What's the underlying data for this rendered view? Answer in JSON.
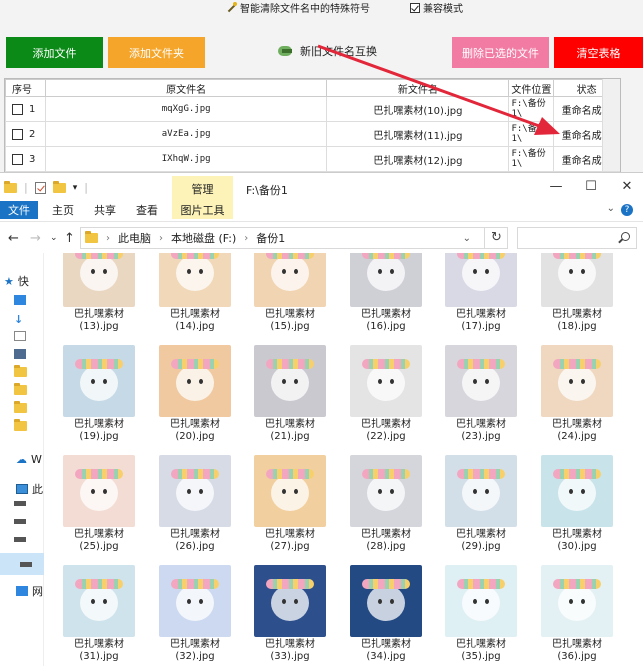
{
  "app": {
    "clean_option": "智能清除文件名中的特殊符号",
    "compat_option": "兼容模式",
    "compat_checked": true,
    "buttons": {
      "add_file": "添加文件",
      "add_folder": "添加文件夹",
      "swap_names": "新旧文件名互换",
      "delete_selected": "删除已选的文件",
      "clear_table": "清空表格"
    },
    "table": {
      "headers": [
        "序号",
        "原文件名",
        "新文件名",
        "文件位置",
        "状态"
      ],
      "rows": [
        {
          "index": "1",
          "original": "mqXgG.jpg",
          "new": "巴扎嘿素材(10).jpg",
          "location": "F:\\备份1\\",
          "status": "重命名成功"
        },
        {
          "index": "2",
          "original": "aVzEa.jpg",
          "new": "巴扎嘿素材(11).jpg",
          "location": "F:\\备份1\\",
          "status": "重命名成功"
        },
        {
          "index": "3",
          "original": "IXhqW.jpg",
          "new": "巴扎嘿素材(12).jpg",
          "location": "F:\\备份1\\",
          "status": "重命名成功"
        }
      ]
    }
  },
  "explorer": {
    "title_path": "F:\\备份1",
    "manage_tab": "管理",
    "picture_tools_tab": "图片工具",
    "ribbon_tabs": [
      "文件",
      "主页",
      "共享",
      "查看"
    ],
    "breadcrumb": [
      "此电脑",
      "本地磁盘 (F:)",
      "备份1"
    ],
    "search_placeholder": "",
    "sidebar": [
      {
        "label": "快",
        "icon": "star-icon"
      },
      {
        "label": "W",
        "icon": "cloud-icon"
      },
      {
        "label": "此",
        "icon": "computer-icon"
      },
      {
        "label": "网",
        "icon": "network-icon"
      }
    ],
    "files": [
      {
        "name": "巴扎嘿素材",
        "num": "(13).jpg",
        "color": "#e9d7c2"
      },
      {
        "name": "巴扎嘿素材",
        "num": "(14).jpg",
        "color": "#f0d8b8"
      },
      {
        "name": "巴扎嘿素材",
        "num": "(15).jpg",
        "color": "#f1d4b2"
      },
      {
        "name": "巴扎嘿素材",
        "num": "(16).jpg",
        "color": "#cfcfd6"
      },
      {
        "name": "巴扎嘿素材",
        "num": "(17).jpg",
        "color": "#d9d9e6"
      },
      {
        "name": "巴扎嘿素材",
        "num": "(18).jpg",
        "color": "#e2e2e2"
      },
      {
        "name": "巴扎嘿素材",
        "num": "(19).jpg",
        "color": "#c6d9e6"
      },
      {
        "name": "巴扎嘿素材",
        "num": "(20).jpg",
        "color": "#f0c9a0"
      },
      {
        "name": "巴扎嘿素材",
        "num": "(21).jpg",
        "color": "#c9c9cf"
      },
      {
        "name": "巴扎嘿素材",
        "num": "(22).jpg",
        "color": "#e4e4e4"
      },
      {
        "name": "巴扎嘿素材",
        "num": "(23).jpg",
        "color": "#d6d6dc"
      },
      {
        "name": "巴扎嘿素材",
        "num": "(24).jpg",
        "color": "#efd8bf"
      },
      {
        "name": "巴扎嘿素材",
        "num": "(25).jpg",
        "color": "#f3dcd3"
      },
      {
        "name": "巴扎嘿素材",
        "num": "(26).jpg",
        "color": "#d6dbe6"
      },
      {
        "name": "巴扎嘿素材",
        "num": "(27).jpg",
        "color": "#f2cf9f"
      },
      {
        "name": "巴扎嘿素材",
        "num": "(28).jpg",
        "color": "#d4d6dc"
      },
      {
        "name": "巴扎嘿素材",
        "num": "(29).jpg",
        "color": "#d3dfe8"
      },
      {
        "name": "巴扎嘿素材",
        "num": "(30).jpg",
        "color": "#c8e4ea"
      },
      {
        "name": "巴扎嘿素材",
        "num": "(31).jpg",
        "color": "#cfe3ec"
      },
      {
        "name": "巴扎嘿素材",
        "num": "(32).jpg",
        "color": "#cdd9f0"
      },
      {
        "name": "巴扎嘿素材",
        "num": "(33).jpg",
        "color": "#2d4f8c"
      },
      {
        "name": "巴扎嘿素材",
        "num": "(34).jpg",
        "color": "#244a83"
      },
      {
        "name": "巴扎嘿素材",
        "num": "(35).jpg",
        "color": "#dff0f5"
      },
      {
        "name": "巴扎嘿素材",
        "num": "(36).jpg",
        "color": "#e3f1f4"
      }
    ]
  },
  "colors": {
    "add_file": "#0b8a17",
    "add_folder": "#f5a52a",
    "delete": "#f27ba4",
    "clear": "#ff0000",
    "arrow": "#e3273a"
  }
}
